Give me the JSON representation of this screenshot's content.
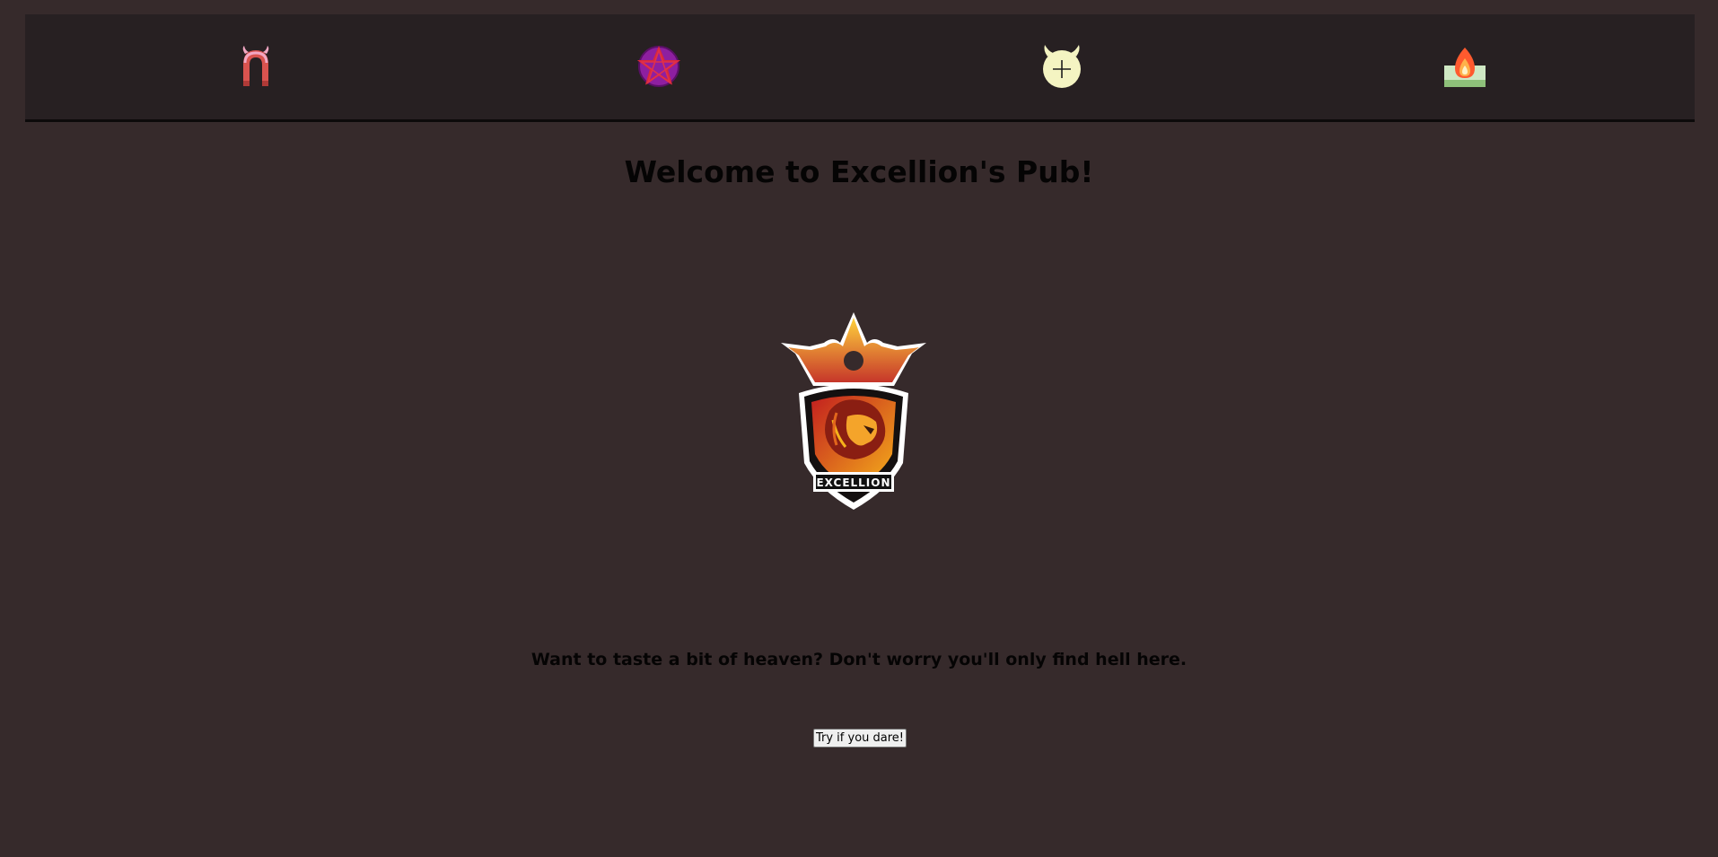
{
  "nav": {
    "items": [
      {
        "icon": "horned-arch-icon"
      },
      {
        "icon": "pentagram-icon"
      },
      {
        "icon": "horned-plus-icon"
      },
      {
        "icon": "flame-tray-icon"
      }
    ]
  },
  "main": {
    "title": "Welcome to Excellion's Pub!",
    "logo_text": "EXCELLION",
    "tagline": "Want to taste a bit of heaven? Don't worry you'll only find hell here.",
    "cta_label": "Try if you dare!"
  },
  "colors": {
    "background": "#362a2b",
    "navbar": "#272022",
    "text": "#050404",
    "accent_red": "#d9534f",
    "accent_purple": "#8e1fa0",
    "accent_cream": "#f4f4c2",
    "accent_gold": "#f6b21b"
  }
}
